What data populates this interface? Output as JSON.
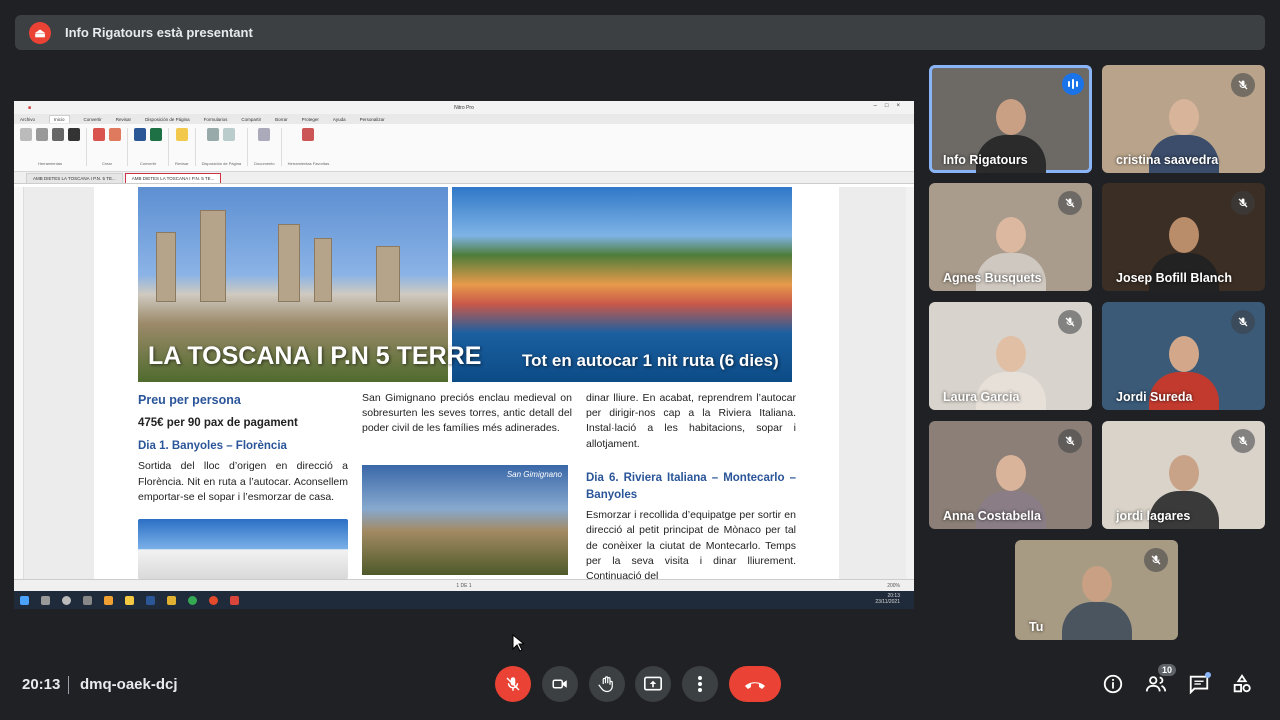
{
  "banner": {
    "presenter_text": "Info Rigatours està presentant",
    "icon": "present-to-all-icon"
  },
  "nitro": {
    "window_title": "Nitro Pro",
    "menu_tabs": [
      "Archivo",
      "Inicio",
      "Convertir",
      "Revisar",
      "Disposición de Página",
      "Formularios",
      "Compartir",
      "Borrar",
      "Proteger",
      "Ayuda",
      "Personalizar"
    ],
    "active_menu_tab": "Inicio",
    "ribbon_groups": [
      "Herramientas",
      "Crear",
      "Convertir",
      "Revisar",
      "Disposición de Página",
      "Documento",
      "Herramientas Favoritas"
    ],
    "doc_tabs": [
      "AMB DIETES LA TOSCANA I P.N. 5 TE...",
      "AMB DIETES LA TOSCANA I P.N. 5 TE..."
    ],
    "page_indicator": "1 DE 1",
    "zoom": "200%",
    "taskbar_time": "20:13",
    "taskbar_date": "23/11/2021"
  },
  "document": {
    "hero_title": "LA TOSCANA I P.N 5 TERRE",
    "hero_subtitle": "Tot en autocar 1 nit ruta (6 dies)",
    "col1": {
      "heading": "Preu per persona",
      "price": "475€ per 90 pax de pagament",
      "day_heading": "Dia 1.  Banyoles – Florència",
      "text": "Sortida del lloc d’origen en direcció a Florència. Nit en ruta a l’autocar. Aconsellem emportar-se el sopar i l’esmorzar de casa."
    },
    "col2": {
      "text": "San Gimignano preciós enclau medieval on sobresurten les seves torres, antic detall del poder civil de les famílies més adinerades.",
      "image_caption": "San Gimignano"
    },
    "col3": {
      "text": "dinar lliure. En acabat, reprendrem l’autocar per dirigir-nos cap a la Riviera Italiana. Instal·lació a les habitacions, sopar i allotjament.",
      "day_heading": "Dia 6. Riviera Italiana – Montecarlo – Banyoles",
      "text2": "Esmorzar i recollida d’equipatge per sortir en direcció al petit principat de Mònaco per tal de conèixer la ciutat de Montecarlo. Temps per la seva visita i dinar lliurement. Continuació del"
    }
  },
  "participants": [
    {
      "name": "Info Rigatours",
      "speaking": true,
      "muted": false,
      "bg": "#6d6a66",
      "skin": "#c9a084",
      "shirt": "#2b2b2b"
    },
    {
      "name": "cristina saavedra",
      "speaking": false,
      "muted": true,
      "bg": "#b9a48b",
      "skin": "#d7b49a",
      "shirt": "#3b4d6b"
    },
    {
      "name": "Agnes Busquets",
      "speaking": false,
      "muted": true,
      "bg": "#a99c8c",
      "skin": "#dcb8a0",
      "shirt": "#cfc8c0"
    },
    {
      "name": "Josep Bofill Blanch",
      "speaking": false,
      "muted": true,
      "bg": "#3b2e24",
      "skin": "#b98c6a",
      "shirt": "#222222"
    },
    {
      "name": "Laura Garcia",
      "speaking": false,
      "muted": true,
      "bg": "#d8d3cc",
      "skin": "#e0bfa5",
      "shirt": "#e6e0d8"
    },
    {
      "name": "Jordi Sureda",
      "speaking": false,
      "muted": true,
      "bg": "#3a5a78",
      "skin": "#d3a88a",
      "shirt": "#c23a2e"
    },
    {
      "name": "Anna Costabella",
      "speaking": false,
      "muted": true,
      "bg": "#8b7f77",
      "skin": "#d9b39a",
      "shirt": "#8a7d86"
    },
    {
      "name": "jordi lagares",
      "speaking": false,
      "muted": true,
      "bg": "#d9d3c9",
      "skin": "#c9a388",
      "shirt": "#3a3a3a"
    },
    {
      "name": "Tu",
      "speaking": false,
      "muted": true,
      "bg": "#a89b84",
      "skin": "#c9a084",
      "shirt": "#4a5560"
    }
  ],
  "bottom_bar": {
    "time": "20:13",
    "meeting_code": "dmq-oaek-dcj",
    "controls": [
      "mic-off-icon",
      "camera-icon",
      "raise-hand-icon",
      "present-icon",
      "more-options-icon",
      "end-call-icon"
    ],
    "people_count": "10",
    "right_icons": [
      "info-icon",
      "people-icon",
      "chat-icon",
      "activities-icon"
    ]
  }
}
